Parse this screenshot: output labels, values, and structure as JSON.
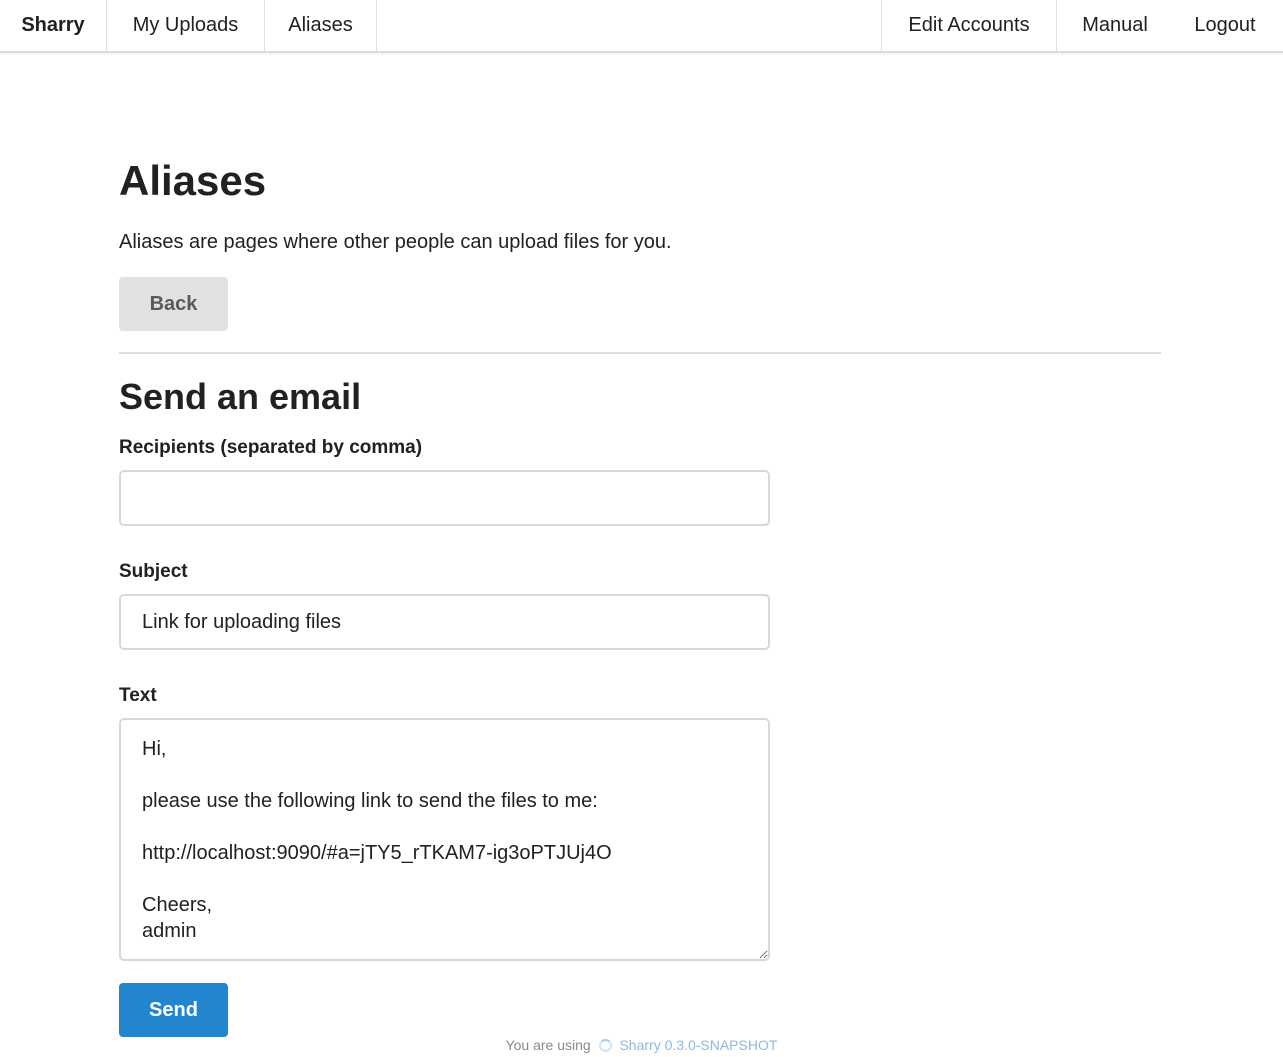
{
  "nav": {
    "brand": "Sharry",
    "my_uploads": "My Uploads",
    "aliases": "Aliases",
    "edit_accounts": "Edit Accounts",
    "manual": "Manual",
    "logout": "Logout"
  },
  "page": {
    "title": "Aliases",
    "description": "Aliases are pages where other people can upload files for you.",
    "back_label": "Back"
  },
  "email_form": {
    "title": "Send an email",
    "recipients_label": "Recipients (separated by comma)",
    "recipients_value": "",
    "subject_label": "Subject",
    "subject_value": "Link for uploading files",
    "text_label": "Text",
    "text_value": "Hi,\n\nplease use the following link to send the files to me:\n\nhttp://localhost:9090/#a=jTY5_rTKAM7-ig3oPTJUj4O\n\nCheers,\nadmin",
    "send_label": "Send"
  },
  "footer": {
    "prefix": "You are using",
    "version_link": "Sharry 0.3.0-SNAPSHOT"
  },
  "colors": {
    "primary": "#2185d0",
    "back_button_bg": "#e0e1e2",
    "border": "#d8d8d8"
  }
}
